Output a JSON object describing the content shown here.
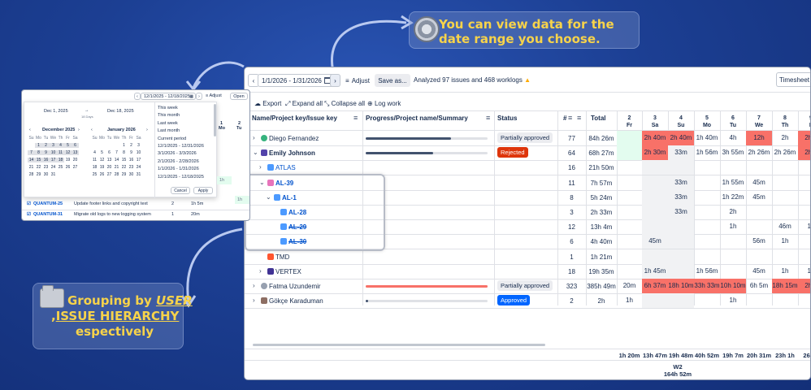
{
  "callouts": {
    "top_text": "You can view data for the date range you choose.",
    "bottom": {
      "l1a": "Grouping by",
      "l1b": "USER",
      "l2a": ",",
      "l2b": "ISSUE HIERARCHY",
      "l3": "espectively"
    }
  },
  "toolbar": {
    "date_range": "1/1/2026 - 1/31/2026",
    "adjust": "Adjust",
    "save_as": "Save as...",
    "analyzed": "Analyzed 97 issues and 468 worklogs",
    "timesheet": "Timesheet"
  },
  "actions": {
    "export": "Export",
    "expand": "Expand all",
    "collapse": "Collapse all",
    "log": "Log work"
  },
  "headers": {
    "name": "Name/Project key/Issue key",
    "progress": "Progress/Project name/Summary",
    "status": "Status",
    "num": "#",
    "total": "Total"
  },
  "days": [
    {
      "n": "2",
      "d": "Fr"
    },
    {
      "n": "3",
      "d": "Sa"
    },
    {
      "n": "4",
      "d": "Su"
    },
    {
      "n": "5",
      "d": "Mo"
    },
    {
      "n": "6",
      "d": "Tu"
    },
    {
      "n": "7",
      "d": "We"
    },
    {
      "n": "8",
      "d": "Th"
    },
    {
      "n": "9",
      "d": "F"
    }
  ],
  "rows": [
    {
      "name": "Diego Fernandez",
      "status": "Partially approved",
      "num": "77",
      "total": "84h 26m",
      "cells": [
        "",
        "2h 40m",
        "2h 40m",
        "1h 40m",
        "4h",
        "12h",
        "2h",
        "2h 4"
      ],
      "progress": 0.7
    },
    {
      "name": "Emily Johnson",
      "status": "Rejected",
      "num": "64",
      "total": "68h 27m",
      "cells": [
        "",
        "2h 30m",
        "33m",
        "1h 56m",
        "3h 55m",
        "2h 26m",
        "2h 26m",
        "2h 4"
      ],
      "progress": 0.55
    },
    {
      "name": "ATLAS",
      "status": "",
      "num": "16",
      "total": "21h 50m",
      "cells": [
        "",
        "",
        "",
        "",
        "",
        "",
        "",
        ""
      ]
    },
    {
      "name": "AL-39",
      "status": "",
      "num": "11",
      "total": "7h 57m",
      "cells": [
        "",
        "",
        "33m",
        "",
        "1h 55m",
        "45m",
        "",
        ""
      ]
    },
    {
      "name": "AL-1",
      "status": "",
      "num": "8",
      "total": "5h 24m",
      "cells": [
        "",
        "",
        "33m",
        "",
        "1h 22m",
        "45m",
        "",
        ""
      ]
    },
    {
      "name": "AL-28",
      "status": "",
      "num": "3",
      "total": "2h 33m",
      "cells": [
        "",
        "",
        "33m",
        "",
        "2h",
        "",
        "",
        ""
      ]
    },
    {
      "name": "AL-29",
      "status": "",
      "num": "12",
      "total": "13h 4m",
      "cells": [
        "",
        "",
        "",
        "",
        "1h",
        "",
        "46m",
        "1h"
      ]
    },
    {
      "name": "AL-30",
      "status": "",
      "num": "6",
      "total": "4h 40m",
      "cells": [
        "",
        "45m",
        "",
        "",
        "",
        "56m",
        "1h",
        ""
      ]
    },
    {
      "name": "TMD",
      "status": "",
      "num": "1",
      "total": "1h 21m",
      "cells": [
        "",
        "",
        "",
        "",
        "",
        "",
        "",
        ""
      ]
    },
    {
      "name": "VERTEX",
      "status": "",
      "num": "18",
      "total": "19h 35m",
      "cells": [
        "",
        "1h 45m",
        "",
        "1h 56m",
        "",
        "45m",
        "1h",
        "1h"
      ]
    },
    {
      "name": "Fatma Uzundemir",
      "status": "Partially approved",
      "num": "323",
      "total": "385h 49m",
      "cells": [
        "20m",
        "6h 37m",
        "18h 10m",
        "33h 33m",
        "10h 10m",
        "6h 5m",
        "18h 15m",
        "2h 3"
      ],
      "progress": 1.0
    },
    {
      "name": "Gökçe Karaduman",
      "status": "Approved",
      "num": "2",
      "total": "2h",
      "cells": [
        "1h",
        "",
        "",
        "",
        "1h",
        "",
        "",
        ""
      ],
      "progress": 0.02
    }
  ],
  "footer_totals": [
    "1h 20m",
    "13h 47m",
    "19h 48m",
    "40h 52m",
    "19h 7m",
    "20h 31m",
    "23h 1h",
    "26h 3"
  ],
  "week": {
    "label": "W2",
    "total": "164h 52m"
  },
  "popup": {
    "range": "12/1/2025 - 12/18/2025",
    "adjust": "Adjust",
    "open": "Open",
    "from": "Dec 1, 2025",
    "to": "Dec 18, 2025",
    "arrow": "→",
    "days": "18 Days",
    "month1": "December 2025",
    "month2": "January 2026",
    "weekdays": [
      "Su",
      "Mo",
      "Tu",
      "We",
      "Th",
      "Fr",
      "Sa"
    ],
    "presets": [
      "This week",
      "This month",
      "Last week",
      "Last month",
      "Current period",
      "12/1/2025 - 12/31/2026",
      "3/1/2026 - 3/3/2026",
      "2/1/2026 - 2/28/2026",
      "1/1/2026 - 1/31/2026",
      "12/1/2025 - 12/18/2025"
    ],
    "cancel": "Cancel",
    "apply": "Apply",
    "cols": [
      {
        "n": "1",
        "d": "Mo"
      },
      {
        "n": "2",
        "d": "Tu"
      }
    ],
    "rows": [
      {
        "key": "QUANTUM-25",
        "summary": "Update footer links and copyright text",
        "num": "2",
        "total": "1h 5m"
      },
      {
        "key": "QUANTUM-31",
        "summary": "Migrate old logs to new logging system",
        "num": "1",
        "total": "20m"
      }
    ]
  }
}
